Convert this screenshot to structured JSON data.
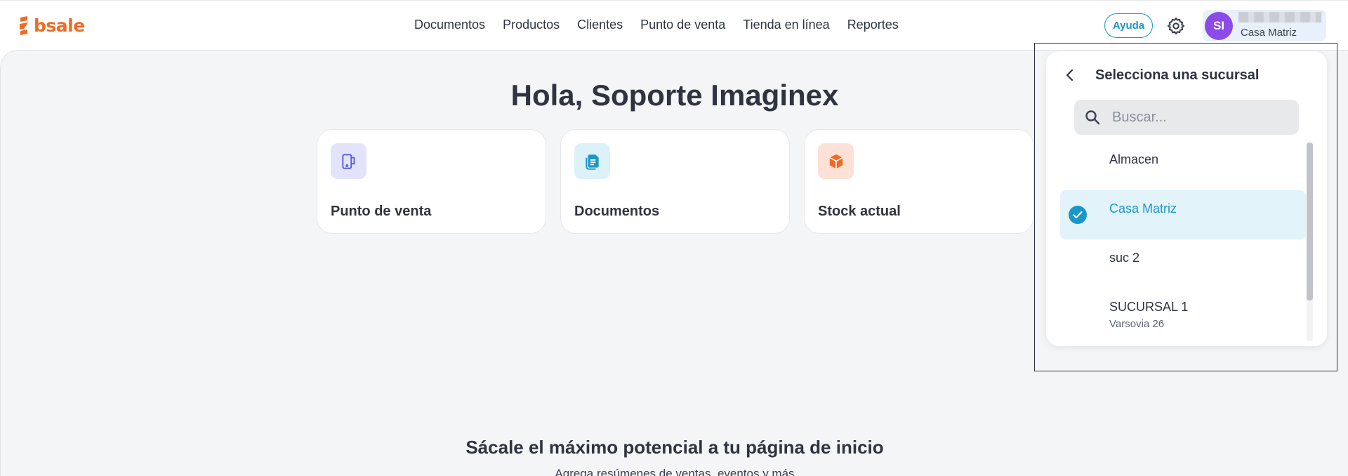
{
  "brand": {
    "name": "bsale",
    "color": "#f26a21"
  },
  "nav": {
    "items": [
      {
        "label": "Documentos"
      },
      {
        "label": "Productos"
      },
      {
        "label": "Clientes"
      },
      {
        "label": "Punto de venta"
      },
      {
        "label": "Tienda en línea"
      },
      {
        "label": "Reportes"
      }
    ]
  },
  "header": {
    "help_label": "Ayuda",
    "settings_icon": "gear-icon",
    "user": {
      "initials": "SI",
      "branch": "Casa Matriz",
      "avatar_color": "#8c4be8"
    }
  },
  "main": {
    "greeting": "Hola, Soporte Imaginex",
    "cards": [
      {
        "label": "Punto de venta",
        "icon": "pos-terminal-icon",
        "icon_bg": "#e3e4fb"
      },
      {
        "label": "Documentos",
        "icon": "document-icon",
        "icon_bg": "#dcf1f8"
      },
      {
        "label": "Stock actual",
        "icon": "box-icon",
        "icon_bg": "#fde0d6"
      }
    ],
    "promo_title": "Sácale el máximo potencial a tu página de inicio",
    "promo_subtitle": "Agrega resúmenes de ventas, eventos y más"
  },
  "branch_selector": {
    "title": "Selecciona una sucursal",
    "search_placeholder": "Buscar...",
    "branches": [
      {
        "name": "Almacen",
        "address": "",
        "selected": false
      },
      {
        "name": "Casa Matriz",
        "address": "",
        "selected": true
      },
      {
        "name": "suc 2",
        "address": "",
        "selected": false
      },
      {
        "name": "SUCURSAL 1",
        "address": "Varsovia 26",
        "selected": false
      }
    ]
  },
  "colors": {
    "accent": "#1a97c9",
    "selected_bg": "#e2f3f9",
    "page_bg": "#f4f5f7"
  }
}
